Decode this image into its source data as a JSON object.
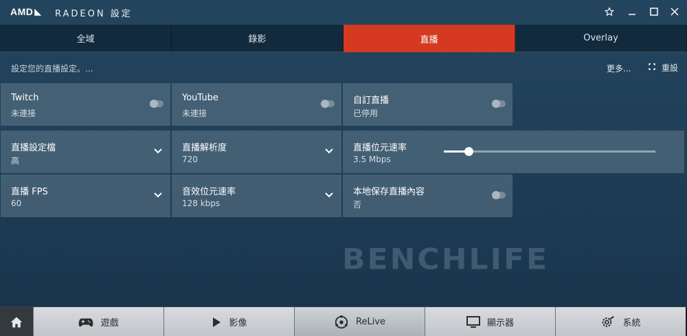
{
  "titlebar": {
    "brand": "AMD",
    "brand_mark": "◣",
    "app_name": "RADEON 設定",
    "controls": [
      "star-icon",
      "minimize-icon",
      "maximize-icon",
      "close-icon"
    ]
  },
  "tabs": [
    {
      "label": "全域"
    },
    {
      "label": "錄影"
    },
    {
      "label": "直播",
      "active": true
    },
    {
      "label": "Overlay"
    }
  ],
  "subheader": {
    "text": "設定您的直播設定。...",
    "more_label": "更多...",
    "reset_label": "重設"
  },
  "cards": {
    "twitch": {
      "title": "Twitch",
      "value": "未連接",
      "toggle": false
    },
    "youtube": {
      "title": "YouTube",
      "value": "未連接",
      "toggle": false
    },
    "custom": {
      "title": "自訂直播",
      "value": "已停用",
      "toggle": false
    },
    "profile": {
      "title": "直播設定檔",
      "value": "高"
    },
    "resolution": {
      "title": "直播解析度",
      "value": "720"
    },
    "bitrate": {
      "title": "直播位元速率",
      "value": "3.5 Mbps",
      "slider_level": 0.12
    },
    "fps": {
      "title": "直播 FPS",
      "value": "60"
    },
    "audio_bitrate": {
      "title": "音效位元速率",
      "value": "128 kbps"
    },
    "local_save": {
      "title": "本地保存直播內容",
      "value": "否",
      "toggle": false
    }
  },
  "watermark": "BENCHLIFE",
  "bottombar": {
    "home_icon": "home-icon",
    "items": [
      {
        "label": "遊戲",
        "icon": "gamepad-icon"
      },
      {
        "label": "影像",
        "icon": "play-icon"
      },
      {
        "label": "ReLive",
        "icon": "relive-icon",
        "active": true
      },
      {
        "label": "顯示器",
        "icon": "monitor-icon"
      },
      {
        "label": "系統",
        "icon": "gear-icon"
      }
    ]
  },
  "colors": {
    "accent": "#d53a20",
    "background": "#1f4058"
  }
}
